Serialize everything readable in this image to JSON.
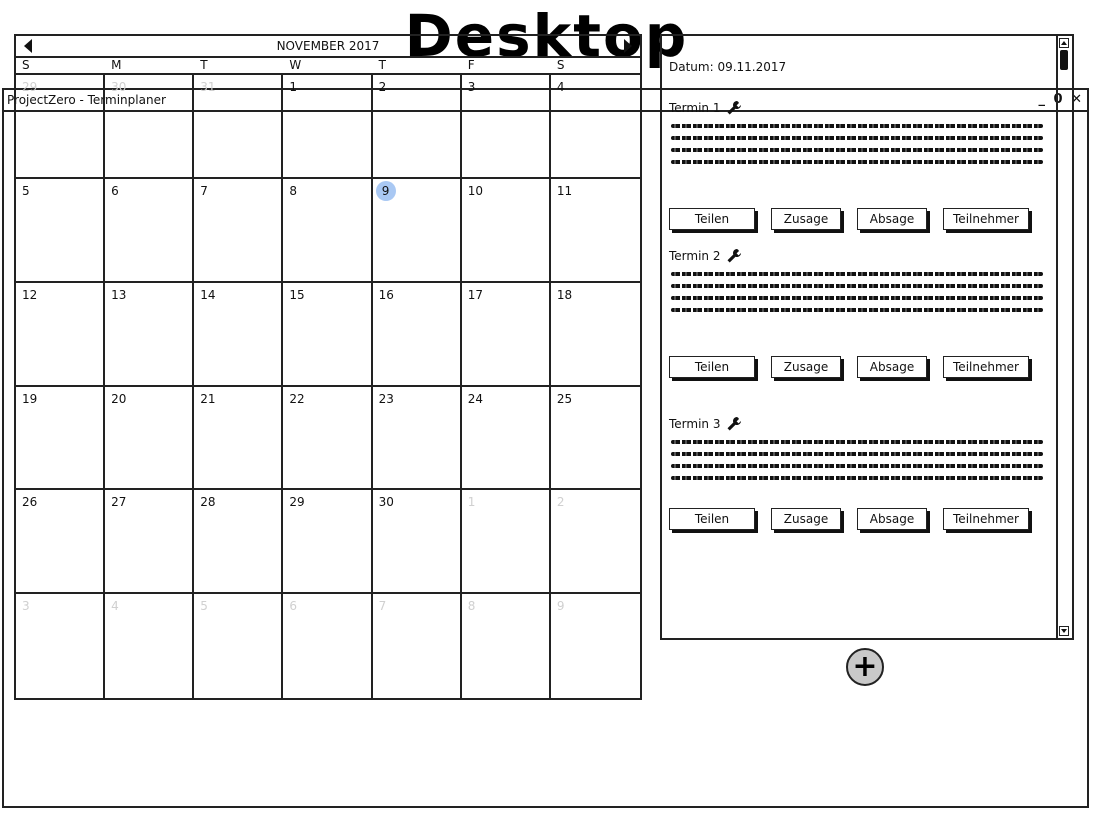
{
  "page_heading": "Desktop",
  "window": {
    "title": "ProjectZero - Terminplaner",
    "controls": {
      "minimize": "_",
      "maximize": "0",
      "close": "✕"
    }
  },
  "calendar": {
    "month_label": "NOVEMBER 2017",
    "weekdays": [
      "S",
      "M",
      "T",
      "W",
      "T",
      "F",
      "S"
    ],
    "cells": [
      {
        "day": "29",
        "muted": true
      },
      {
        "day": "30",
        "muted": true
      },
      {
        "day": "31",
        "muted": true
      },
      {
        "day": "1"
      },
      {
        "day": "2"
      },
      {
        "day": "3"
      },
      {
        "day": "4"
      },
      {
        "day": "5"
      },
      {
        "day": "6"
      },
      {
        "day": "7"
      },
      {
        "day": "8"
      },
      {
        "day": "9",
        "today": true
      },
      {
        "day": "10"
      },
      {
        "day": "11"
      },
      {
        "day": "12"
      },
      {
        "day": "13"
      },
      {
        "day": "14"
      },
      {
        "day": "15"
      },
      {
        "day": "16"
      },
      {
        "day": "17"
      },
      {
        "day": "18"
      },
      {
        "day": "19"
      },
      {
        "day": "20"
      },
      {
        "day": "21"
      },
      {
        "day": "22"
      },
      {
        "day": "23"
      },
      {
        "day": "24"
      },
      {
        "day": "25"
      },
      {
        "day": "26"
      },
      {
        "day": "27"
      },
      {
        "day": "28"
      },
      {
        "day": "29"
      },
      {
        "day": "30"
      },
      {
        "day": "1",
        "muted": true
      },
      {
        "day": "2",
        "muted": true
      },
      {
        "day": "3",
        "muted": true
      },
      {
        "day": "4",
        "muted": true
      },
      {
        "day": "5",
        "muted": true
      },
      {
        "day": "6",
        "muted": true
      },
      {
        "day": "7",
        "muted": true
      },
      {
        "day": "8",
        "muted": true
      },
      {
        "day": "9",
        "muted": true
      }
    ],
    "today_color": "#a9c8f3"
  },
  "panel": {
    "datum": "Datum: 09.11.2017",
    "termine": [
      {
        "title": "Termin 1",
        "icon": "wrench-icon"
      },
      {
        "title": "Termin 2",
        "icon": "wrench-icon"
      },
      {
        "title": "Termin 3",
        "icon": "wrench-icon"
      }
    ],
    "buttons": {
      "teilen": "Teilen",
      "zusage": "Zusage",
      "absage": "Absage",
      "teilnehmer": "Teilnehmer"
    }
  },
  "add_button": {
    "label": "+",
    "icon": "plus-icon"
  }
}
